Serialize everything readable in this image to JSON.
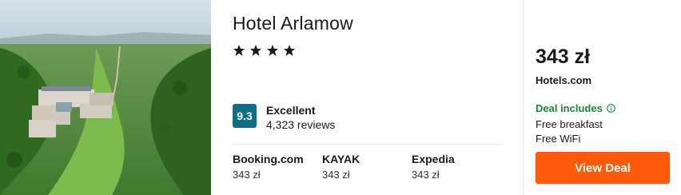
{
  "hotel": {
    "name": "Hotel Arlamow",
    "star_count": 4,
    "rating": {
      "score": "9.3",
      "label": "Excellent",
      "reviews": "4,323 reviews"
    }
  },
  "providers": [
    {
      "name": "Booking.com",
      "price": "343 zł"
    },
    {
      "name": "KAYAK",
      "price": "343 zł"
    },
    {
      "name": "Expedia",
      "price": "343 zł"
    }
  ],
  "deal": {
    "price": "343 zł",
    "site": "Hotels.com",
    "includes_title": "Deal includes",
    "perks": [
      "Free breakfast",
      "Free WiFi"
    ],
    "button_label": "View Deal"
  },
  "colors": {
    "score_badge": "#0d6e86",
    "deal_green": "#178b3a",
    "button_orange": "#ff5a0a"
  }
}
